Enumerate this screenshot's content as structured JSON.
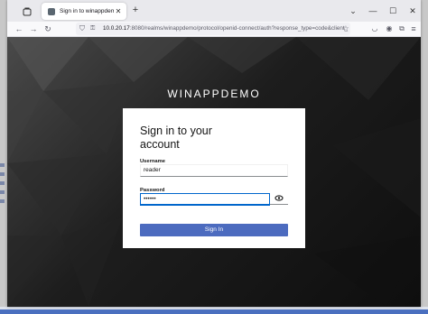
{
  "browser": {
    "tab_title": "Sign in to winappdemo",
    "url_host": "10.0.20.17",
    "url_rest": ":8080/realms/winappdemo/protocol/openid-connect/auth?response_type=code&client_"
  },
  "login": {
    "realm_name": "WINAPPDEMO",
    "heading": "Sign in to your account",
    "username_label": "Username",
    "username_value": "reader",
    "password_label": "Password",
    "password_value": "••••••",
    "signin_label": "Sign In"
  },
  "colors": {
    "primary_button": "#4c6bbf",
    "focus_border": "#0066cc",
    "background_dark": "#0e0e0e"
  },
  "icons": {
    "tab_overview": "tab-overview-icon",
    "new_tab": "plus-icon",
    "back": "back-arrow-icon",
    "forward": "forward-arrow-icon",
    "reload": "reload-icon",
    "shield": "shield-icon",
    "lock": "lock-icon",
    "bookmark": "star-icon",
    "pocket": "pocket-icon",
    "account": "account-icon",
    "extensions": "extensions-icon",
    "menu": "hamburger-menu-icon",
    "show_password": "eye-icon"
  }
}
